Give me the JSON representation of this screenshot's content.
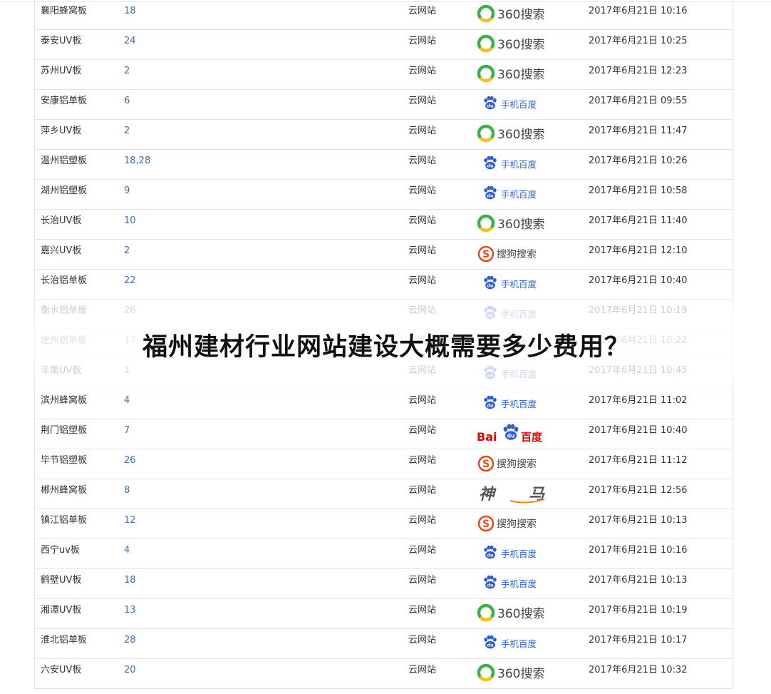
{
  "site_label": "云网站",
  "headline": "福州建材行业网站建设大概需要多少费用？",
  "engine_labels": {
    "360": "360搜索",
    "mbaidu": "手机百度",
    "sogou": "搜狗搜索",
    "baidu_a": "Bai",
    "baidu_b": "百度",
    "shenma": "神马"
  },
  "colors": {
    "rank": "#3a6fb0",
    "so360_green": "#3cb04a",
    "so360_yellow": "#f7c21a",
    "baidu_blue": "#2e5dd6",
    "baidu_red": "#e10602",
    "sogou_red": "#e64a19"
  },
  "rows": [
    {
      "keyword": "襄阳蜂窝板",
      "rank": "18",
      "engine": "360",
      "time": "2017年6月21日 10:16"
    },
    {
      "keyword": "泰安UV板",
      "rank": "24",
      "engine": "360",
      "time": "2017年6月21日 10:25"
    },
    {
      "keyword": "苏州UV板",
      "rank": "2",
      "engine": "360",
      "time": "2017年6月21日 12:23"
    },
    {
      "keyword": "安康铝单板",
      "rank": "6",
      "engine": "mbaidu",
      "time": "2017年6月21日 09:55"
    },
    {
      "keyword": "萍乡UV板",
      "rank": "2",
      "engine": "360",
      "time": "2017年6月21日 11:47"
    },
    {
      "keyword": "温州铝塑板",
      "rank": "18,28",
      "engine": "mbaidu",
      "time": "2017年6月21日 10:26"
    },
    {
      "keyword": "湖州铝塑板",
      "rank": "9",
      "engine": "mbaidu",
      "time": "2017年6月21日 10:58"
    },
    {
      "keyword": "长治UV板",
      "rank": "10",
      "engine": "360",
      "time": "2017年6月21日 11:40"
    },
    {
      "keyword": "嘉兴UV板",
      "rank": "2",
      "engine": "sogou",
      "time": "2017年6月21日 12:10"
    },
    {
      "keyword": "长治铝单板",
      "rank": "22",
      "engine": "mbaidu",
      "time": "2017年6月21日 10:40"
    },
    {
      "keyword": "衡水铝单板",
      "rank": "26",
      "engine": "mbaidu",
      "time": "2017年6月21日 10:19",
      "style": "faded"
    },
    {
      "keyword": "定州铝单板",
      "rank": "17",
      "engine": "mbaidu",
      "time": "2017年6月21日 10:22",
      "style": "faded"
    },
    {
      "keyword": "辛集UV板",
      "rank": "1",
      "engine": "mbaidu",
      "time": "2017年6月21日 10:45",
      "style": "faded"
    },
    {
      "keyword": "滨州蜂窝板",
      "rank": "4",
      "engine": "mbaidu",
      "time": "2017年6月21日 11:02"
    },
    {
      "keyword": "荆门铝塑板",
      "rank": "7",
      "engine": "baidu",
      "time": "2017年6月21日 10:40"
    },
    {
      "keyword": "毕节铝塑板",
      "rank": "26",
      "engine": "sogou",
      "time": "2017年6月21日 11:12"
    },
    {
      "keyword": "郴州蜂窝板",
      "rank": "8",
      "engine": "shenma",
      "time": "2017年6月21日 12:56"
    },
    {
      "keyword": "镇江铝单板",
      "rank": "12",
      "engine": "sogou",
      "time": "2017年6月21日 10:13"
    },
    {
      "keyword": "西宁uv板",
      "rank": "4",
      "engine": "mbaidu",
      "time": "2017年6月21日 10:16"
    },
    {
      "keyword": "鹤壁UV板",
      "rank": "18",
      "engine": "mbaidu",
      "time": "2017年6月21日 10:13"
    },
    {
      "keyword": "湘潭UV板",
      "rank": "13",
      "engine": "360",
      "time": "2017年6月21日 10:19"
    },
    {
      "keyword": "淮北铝单板",
      "rank": "28",
      "engine": "mbaidu",
      "time": "2017年6月21日 10:17"
    },
    {
      "keyword": "六安UV板",
      "rank": "20",
      "engine": "360",
      "time": "2017年6月21日 10:32"
    }
  ]
}
